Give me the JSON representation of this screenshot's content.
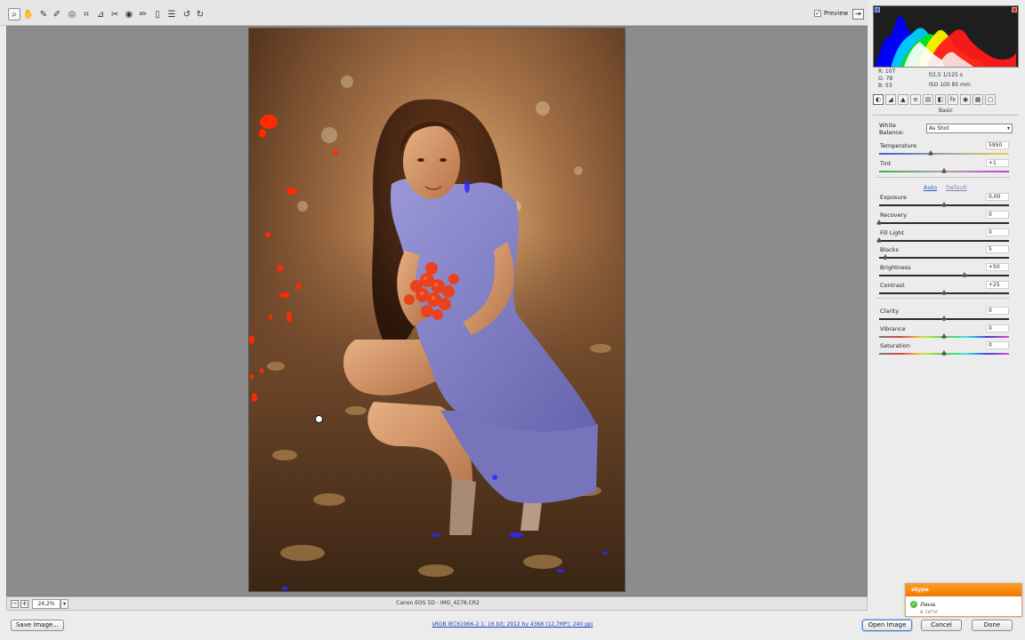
{
  "toolbar": {
    "tools": [
      {
        "icon": "zoom-icon",
        "glyph": "⌕"
      },
      {
        "icon": "hand-icon",
        "glyph": "✋"
      },
      {
        "icon": "white-balance-icon",
        "glyph": "✎"
      },
      {
        "icon": "color-sampler-icon",
        "glyph": "✐"
      },
      {
        "icon": "target-adjust-icon",
        "glyph": "◎"
      },
      {
        "icon": "crop-icon",
        "glyph": "⌗"
      },
      {
        "icon": "straighten-icon",
        "glyph": "⊿"
      },
      {
        "icon": "spot-removal-icon",
        "glyph": "✂"
      },
      {
        "icon": "red-eye-icon",
        "glyph": "◉"
      },
      {
        "icon": "adjustment-brush-icon",
        "glyph": "✏"
      },
      {
        "icon": "graduated-filter-icon",
        "glyph": "▯"
      },
      {
        "icon": "preferences-icon",
        "glyph": "☰"
      },
      {
        "icon": "rotate-left-icon",
        "glyph": "↺"
      },
      {
        "icon": "rotate-right-icon",
        "glyph": "↻"
      }
    ],
    "preview_label": "Preview",
    "preview_checked": "✓"
  },
  "zoom": {
    "minus": "−",
    "plus": "+",
    "value": "24,2%",
    "dropdown": "▾"
  },
  "camera_info": "Canon EOS 5D  -  IMG_4278.CR2",
  "readout": {
    "r": "R:  107",
    "g": "G:   78",
    "b": "B:   53"
  },
  "exif": {
    "line1": "f/2,5   1/125 s",
    "line2": "ISO 100   85 mm"
  },
  "panel": {
    "tabs": [
      "◐",
      "◢",
      "▲",
      "≡",
      "▤",
      "◧",
      "fx",
      "◉",
      "▦",
      "▢"
    ],
    "section_title": "Basic",
    "white_balance_label": "White Balance:",
    "white_balance_value": "As Shot",
    "auto_label": "Auto",
    "default_label": "Default",
    "sliders": [
      {
        "label": "Temperature",
        "value": "5950",
        "pos": 0.4,
        "track": "temp"
      },
      {
        "label": "Tint",
        "value": "+1",
        "pos": 0.5,
        "track": "tint"
      },
      {
        "label": "Exposure",
        "value": "0,00",
        "pos": 0.5,
        "track": "plain"
      },
      {
        "label": "Recovery",
        "value": "0",
        "pos": 0.0,
        "track": "plain"
      },
      {
        "label": "Fill Light",
        "value": "0",
        "pos": 0.0,
        "track": "plain"
      },
      {
        "label": "Blacks",
        "value": "5",
        "pos": 0.05,
        "track": "plain"
      },
      {
        "label": "Brightness",
        "value": "+50",
        "pos": 0.66,
        "track": "plain"
      },
      {
        "label": "Contrast",
        "value": "+25",
        "pos": 0.5,
        "track": "plain"
      },
      {
        "label": "Clarity",
        "value": "0",
        "pos": 0.5,
        "track": "plain"
      },
      {
        "label": "Vibrance",
        "value": "0",
        "pos": 0.5,
        "track": "color"
      },
      {
        "label": "Saturation",
        "value": "0",
        "pos": 0.5,
        "track": "color"
      }
    ]
  },
  "buttons": {
    "save": "Save Image...",
    "open": "Open Image",
    "cancel": "Cancel",
    "done": "Done"
  },
  "workflow_link": "sRGB IEC61966-2.1; 16 bit; 2912 by 4368 (12,7MP); 240 ppi",
  "skype": {
    "title": "skype",
    "name": "Лена",
    "status": "в сети"
  },
  "colors": {
    "clip_warning": "#ff2a00",
    "shadow_warning": "#2a2aff",
    "dress": "#7f7cc4",
    "berries": "#e8431c"
  }
}
